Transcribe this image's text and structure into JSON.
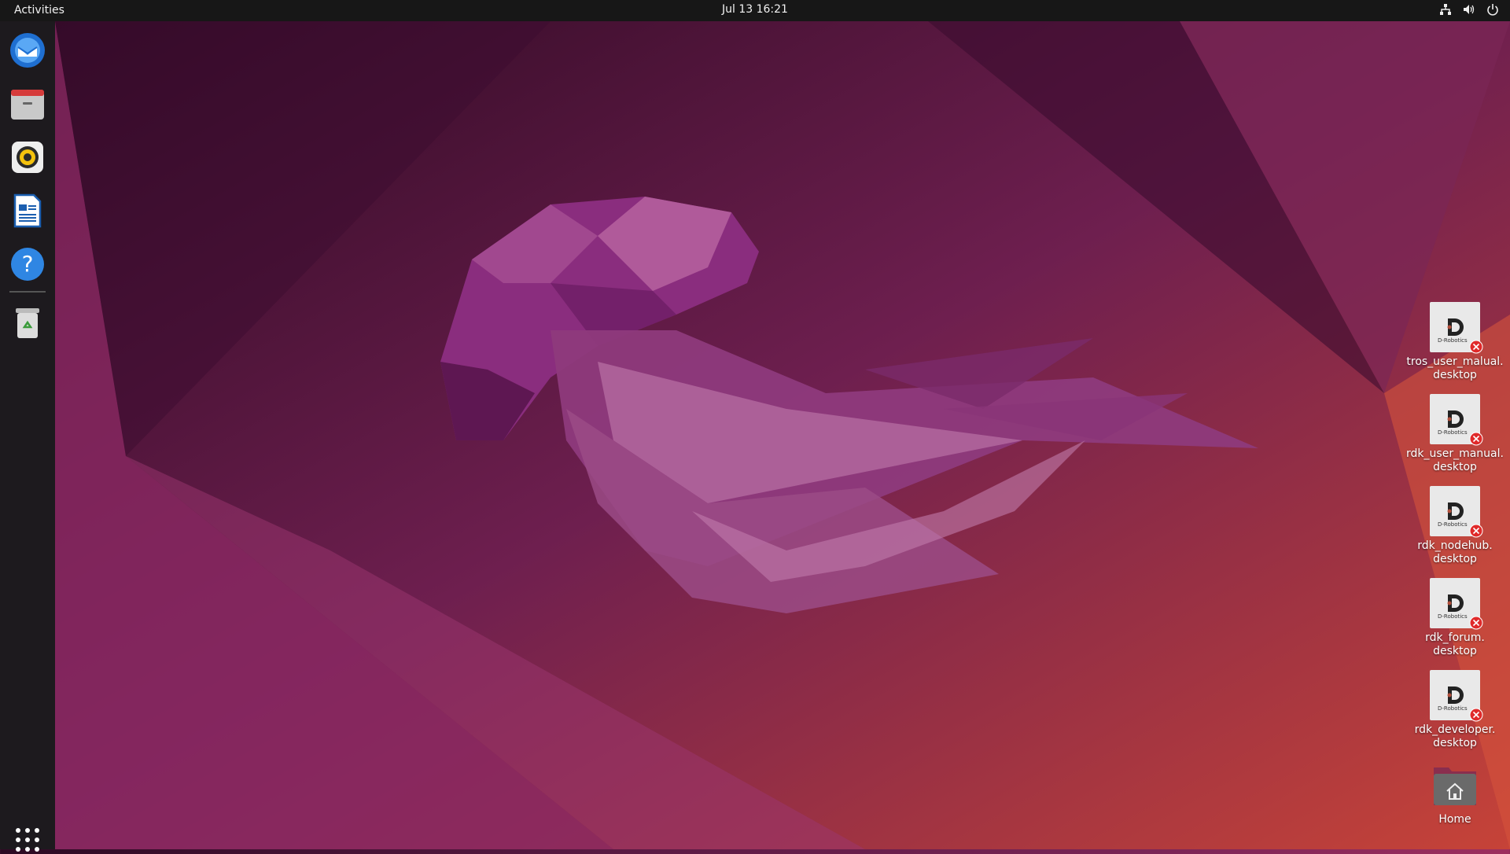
{
  "topbar": {
    "activities_label": "Activities",
    "clock": "Jul 13  16:21",
    "tray_icons": [
      "network-icon",
      "volume-icon",
      "power-icon"
    ]
  },
  "dock": {
    "items": [
      {
        "name": "thunderbird-icon",
        "app": "Thunderbird Mail"
      },
      {
        "name": "files-icon",
        "app": "Files"
      },
      {
        "name": "rhythmbox-icon",
        "app": "Rhythmbox"
      },
      {
        "name": "writer-icon",
        "app": "LibreOffice Writer"
      },
      {
        "name": "help-icon",
        "app": "Help"
      },
      {
        "name": "trash-icon",
        "app": "Trash"
      }
    ],
    "show_apps_icon": "app-grid-icon"
  },
  "desktop": {
    "icons": [
      {
        "line1": "tros_user_malual.",
        "line2": "desktop",
        "logo_text": "D-Robotics"
      },
      {
        "line1": "rdk_user_manual.",
        "line2": "desktop",
        "logo_text": "D-Robotics"
      },
      {
        "line1": "rdk_nodehub.",
        "line2": "desktop",
        "logo_text": "D-Robotics"
      },
      {
        "line1": "rdk_forum.",
        "line2": "desktop",
        "logo_text": "D-Robotics"
      },
      {
        "line1": "rdk_developer.",
        "line2": "desktop",
        "logo_text": "D-Robotics"
      }
    ],
    "home_label": "Home"
  },
  "colors": {
    "topbar": "#171717",
    "dock": "#1d1a1e",
    "accent": "#e95420"
  }
}
